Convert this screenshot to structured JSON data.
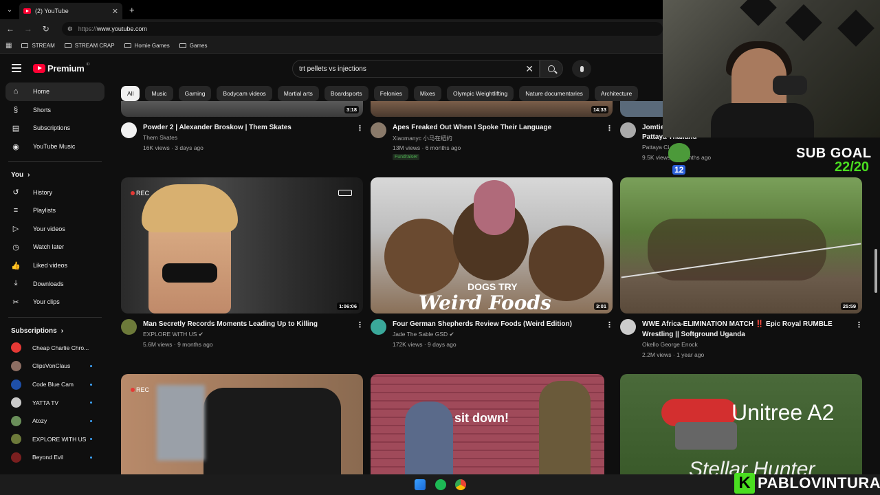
{
  "browser": {
    "tab_title": "(2) YouTube",
    "tab_close": "✕",
    "new_tab": "+",
    "url_scheme": "https://",
    "url_host": "www.youtube.com",
    "bookmarks": [
      "STREAM",
      "STREAM CRAP",
      "Homie Games",
      "Games"
    ]
  },
  "header": {
    "logo_text": "Premium",
    "logo_region": "ID",
    "search_value": "trt pellets vs injections"
  },
  "sidebar": {
    "main": [
      {
        "label": "Home",
        "icon": "home-icon",
        "glyph": "⌂",
        "active": true
      },
      {
        "label": "Shorts",
        "icon": "shorts-icon",
        "glyph": "§"
      },
      {
        "label": "Subscriptions",
        "icon": "subscriptions-icon",
        "glyph": "▤"
      },
      {
        "label": "YouTube Music",
        "icon": "music-icon",
        "glyph": "◉"
      }
    ],
    "you_heading": "You",
    "you": [
      {
        "label": "History",
        "icon": "history-icon",
        "glyph": "↺"
      },
      {
        "label": "Playlists",
        "icon": "playlists-icon",
        "glyph": "≡"
      },
      {
        "label": "Your videos",
        "icon": "your-videos-icon",
        "glyph": "▷"
      },
      {
        "label": "Watch later",
        "icon": "watch-later-icon",
        "glyph": "◷"
      },
      {
        "label": "Liked videos",
        "icon": "like-icon",
        "glyph": "👍"
      },
      {
        "label": "Downloads",
        "icon": "download-icon",
        "glyph": "⤓"
      },
      {
        "label": "Your clips",
        "icon": "clips-icon",
        "glyph": "✂"
      }
    ],
    "subs_heading": "Subscriptions",
    "subscriptions": [
      {
        "label": "Cheap Charlie Chro...",
        "color": "#e53935",
        "dot": false
      },
      {
        "label": "ClipsVonClaus",
        "color": "#8d6e63",
        "dot": true
      },
      {
        "label": "Code Blue Cam",
        "color": "#1e4fa8",
        "dot": true
      },
      {
        "label": "YATTA TV",
        "color": "#c9c9c9",
        "dot": true
      },
      {
        "label": "Atozy",
        "color": "#6a8f5a",
        "dot": true
      },
      {
        "label": "EXPLORE WITH US",
        "color": "#6d7a3a",
        "dot": true
      },
      {
        "label": "Beyond Evil",
        "color": "#7a1f1f",
        "dot": true
      }
    ]
  },
  "chips": [
    "All",
    "Music",
    "Gaming",
    "Bodycam videos",
    "Martial arts",
    "Boardsports",
    "Felonies",
    "Mixes",
    "Olympic Weightlifting",
    "Nature documentaries",
    "Architecture"
  ],
  "videos_row1": [
    {
      "title": "Powder 2 | Alexander Broskow | Them Skates",
      "channel": "Them Skates",
      "stats": "16K views · 3 days ago",
      "duration": "3:18"
    },
    {
      "title": "Apes Freaked Out When I Spoke Their Language",
      "channel": "Xiaomanyc 小马在纽约",
      "stats": "13M views · 6 months ago",
      "duration": "14:33",
      "badge": "Fundraiser"
    },
    {
      "title_line1": "Jomtien",
      "title_line2": "Pattaya Thailand",
      "channel": "Pattaya Ci",
      "stats": "9.5K views · 1 months ago"
    }
  ],
  "videos_row2": [
    {
      "title": "Man Secretly Records Moments Leading Up to Killing",
      "channel": "EXPLORE WITH US",
      "stats": "5.6M views · 9 months ago",
      "duration": "1:06:06",
      "rec": "REC"
    },
    {
      "title": "Four German Shepherds Review Foods (Weird Edition)",
      "channel": "Jade The Sable GSD",
      "stats": "172K views · 9 days ago",
      "duration": "3:01",
      "overlay_small": "DOGS TRY",
      "overlay_big": "Weird Foods"
    },
    {
      "title_line1": "WWE  Africa-ELIMINATION MATCH ‼️ Epic Royal RUMBLE",
      "title_line2": "Wrestling || Softground Uganda",
      "channel": "Okello George Enock",
      "stats": "2.2M views · 1 year ago",
      "duration": "25:59"
    }
  ],
  "videos_row3": [
    {
      "rec": "REC"
    },
    {
      "overlay": "sit down!"
    },
    {
      "overlay": "Unitree A2",
      "overlay2": "Stellar Hunter"
    }
  ],
  "stream": {
    "subgoal_label": "SUB GOAL",
    "subgoal_count": "22/20",
    "pepe_count": "12",
    "brand_letter": "K",
    "brand_name": "PABLOVINTURA"
  }
}
